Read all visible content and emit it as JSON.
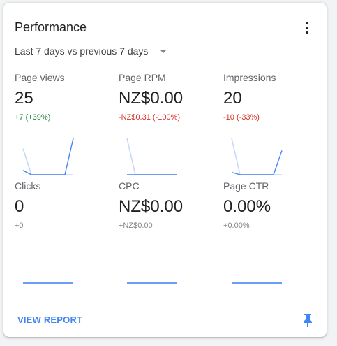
{
  "card": {
    "title": "Performance",
    "menu_icon": "more-vert-icon",
    "date_range": "Last 7 days vs previous 7 days",
    "footer_link": "VIEW REPORT",
    "pin_icon": "pin-icon"
  },
  "colors": {
    "current": "#4285f4",
    "previous": "#c5d9f7",
    "positive": "#188038",
    "negative": "#d93025",
    "neutral": "#80868b"
  },
  "metrics": [
    {
      "label": "Page views",
      "value": "25",
      "delta": "+7 (+39%)",
      "trend": "up",
      "current": [
        3,
        0,
        0,
        0,
        0,
        0,
        25
      ],
      "previous": [
        18,
        0,
        0,
        0,
        0,
        0,
        0
      ]
    },
    {
      "label": "Page RPM",
      "value": "NZ$0.00",
      "delta": "-NZ$0.31 (-100%)",
      "trend": "down",
      "current": [
        0,
        0,
        0,
        0,
        0,
        0,
        0
      ],
      "previous": [
        0.31,
        0,
        0,
        0,
        0,
        0,
        0
      ]
    },
    {
      "label": "Impressions",
      "value": "20",
      "delta": "-10 (-33%)",
      "trend": "down",
      "current": [
        2,
        0,
        0,
        0,
        0,
        0,
        20
      ],
      "previous": [
        30,
        0,
        0,
        0,
        0,
        0,
        0
      ]
    },
    {
      "label": "Clicks",
      "value": "0",
      "delta": "+0",
      "trend": "flat",
      "current": [
        0,
        0,
        0,
        0,
        0,
        0,
        0
      ],
      "previous": [
        0,
        0,
        0,
        0,
        0,
        0,
        0
      ]
    },
    {
      "label": "CPC",
      "value": "NZ$0.00",
      "delta": "+NZ$0.00",
      "trend": "flat",
      "current": [
        0,
        0,
        0,
        0,
        0,
        0,
        0
      ],
      "previous": [
        0,
        0,
        0,
        0,
        0,
        0,
        0
      ]
    },
    {
      "label": "Page CTR",
      "value": "0.00%",
      "delta": "+0.00%",
      "trend": "flat",
      "current": [
        0,
        0,
        0,
        0,
        0,
        0,
        0
      ],
      "previous": [
        0,
        0,
        0,
        0,
        0,
        0,
        0
      ]
    }
  ]
}
